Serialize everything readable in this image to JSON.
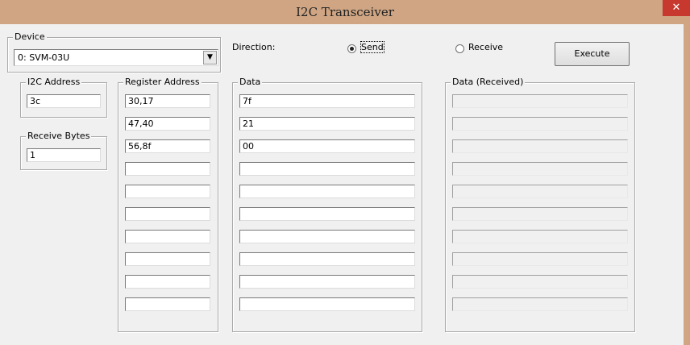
{
  "window": {
    "title": "I2C Transceiver",
    "close_glyph": "✕"
  },
  "device": {
    "label": "Device",
    "selected": "0: SVM-03U",
    "dropdown_glyph": "▼"
  },
  "direction": {
    "label": "Direction:",
    "send_label": "Send",
    "receive_label": "Receive",
    "selected": "Send"
  },
  "execute_label": "Execute",
  "i2c_address": {
    "label": "I2C Address",
    "value": "3c"
  },
  "receive_bytes": {
    "label": "Receive  Bytes",
    "value": "1"
  },
  "register_address": {
    "label": "Register Address",
    "values": [
      "30,17",
      "47,40",
      "56,8f",
      "",
      "",
      "",
      "",
      "",
      "",
      ""
    ]
  },
  "data": {
    "label": "Data",
    "values": [
      "7f",
      "21",
      "00",
      "",
      "",
      "",
      "",
      "",
      "",
      ""
    ]
  },
  "data_received": {
    "label": "Data (Received)",
    "values": [
      "",
      "",
      "",
      "",
      "",
      "",
      "",
      "",
      "",
      ""
    ]
  }
}
